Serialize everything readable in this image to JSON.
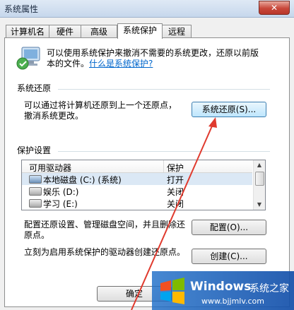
{
  "window": {
    "title": "系统属性",
    "close_glyph": "✕"
  },
  "tabs": [
    {
      "label": "计算机名"
    },
    {
      "label": "硬件"
    },
    {
      "label": "高级"
    },
    {
      "label": "系统保护",
      "active": true
    },
    {
      "label": "远程"
    }
  ],
  "intro": {
    "text_line1": "可以使用系统保护来撤消不需要的系统更改，还原以前版",
    "text_line2": "本的文件。",
    "link": "什么是系统保护?"
  },
  "restore": {
    "group_label": "系统还原",
    "desc_line1": "可以通过将计算机还原到上一个还原点，",
    "desc_line2": "撤消系统更改。",
    "button": "系统还原(S)..."
  },
  "protection": {
    "group_label": "保护设置",
    "columns": [
      "可用驱动器",
      "保护"
    ],
    "drives": [
      {
        "name": "本地磁盘 (C:) (系统)",
        "status": "打开",
        "icon": "system-drive-icon"
      },
      {
        "name": "娱乐 (D:)",
        "status": "关闭",
        "icon": "drive-icon"
      },
      {
        "name": "学习 (E:)",
        "status": "关闭",
        "icon": "drive-icon"
      }
    ],
    "config_line1": "配置还原设置、管理磁盘空间，并且删除还",
    "config_line2": "原点。",
    "config_button": "配置(O)...",
    "create_text": "立刻为启用系统保护的驱动器创建还原点。",
    "create_button": "创建(C)..."
  },
  "footer": {
    "ok_button": "确定"
  },
  "watermark": {
    "brand": "Windows",
    "site_name": "系统之家",
    "url": "www.bjjmlv.com"
  },
  "colors": {
    "link": "#0066cc",
    "arrow": "#e03a2e",
    "selection": "#dbe8f5"
  }
}
